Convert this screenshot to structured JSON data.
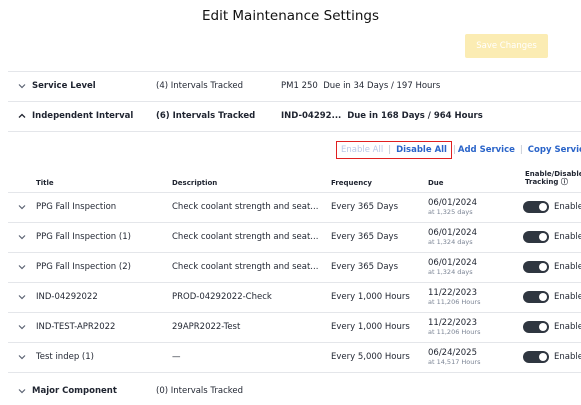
{
  "page_title": "Edit Maintenance Settings",
  "save_button": "Save Changes",
  "sections": [
    {
      "title": "Service Level",
      "count": "(4) Intervals Tracked",
      "detail_code": "PM1 250",
      "detail_rest": "Due in 34 Days / 197 Hours",
      "expanded": false
    },
    {
      "title": "Independent Interval",
      "count": "(6) Intervals Tracked",
      "detail_code": "IND-04292...",
      "detail_rest": "Due in 168 Days / 964 Hours",
      "expanded": true
    },
    {
      "title": "Major Component",
      "count": "(0) Intervals Tracked",
      "detail_code": "",
      "detail_rest": "",
      "expanded": false
    }
  ],
  "bulk_actions": {
    "enable_all": "Enable All",
    "separator": "|",
    "disable_all": "Disable All",
    "add_service": "Add Service",
    "copy_services": "Copy Services"
  },
  "table": {
    "headers": {
      "title": "Title",
      "description": "Description",
      "frequency": "Frequency",
      "due": "Due",
      "tracking_line1": "Enable/Disable",
      "tracking_line2": "Tracking ⓘ"
    },
    "rows": [
      {
        "title": "PPG Fall Inspection",
        "description": "Check coolant strength and seat...",
        "frequency": "Every 365 Days",
        "due": "06/01/2024",
        "due_sub": "at 1,325 days",
        "toggle_label": "Enable"
      },
      {
        "title": "PPG Fall Inspection (1)",
        "description": "Check coolant strength and seat...",
        "frequency": "Every 365 Days",
        "due": "06/01/2024",
        "due_sub": "at 1,324 days",
        "toggle_label": "Enable"
      },
      {
        "title": "PPG Fall Inspection (2)",
        "description": "Check coolant strength and seat...",
        "frequency": "Every 365 Days",
        "due": "06/01/2024",
        "due_sub": "at 1,324 days",
        "toggle_label": "Enable"
      },
      {
        "title": "IND-04292022",
        "description": "PROD-04292022-Check",
        "frequency": "Every 1,000 Hours",
        "due": "11/22/2023",
        "due_sub": "at 11,206 Hours",
        "toggle_label": "Enable"
      },
      {
        "title": "IND-TEST-APR2022",
        "description": "29APR2022-Test",
        "frequency": "Every 1,000 Hours",
        "due": "11/22/2023",
        "due_sub": "at 11,206 Hours",
        "toggle_label": "Enable"
      },
      {
        "title": "Test indep (1)",
        "description": "—",
        "frequency": "Every 5,000 Hours",
        "due": "06/24/2025",
        "due_sub": "at 14,517 Hours",
        "toggle_label": "Enable"
      }
    ]
  },
  "colors": {
    "accent_link": "#2a64c9",
    "save_disabled_bg": "#fbecb3",
    "toggle_on": "#2f3640",
    "highlight_box": "#e02020"
  }
}
